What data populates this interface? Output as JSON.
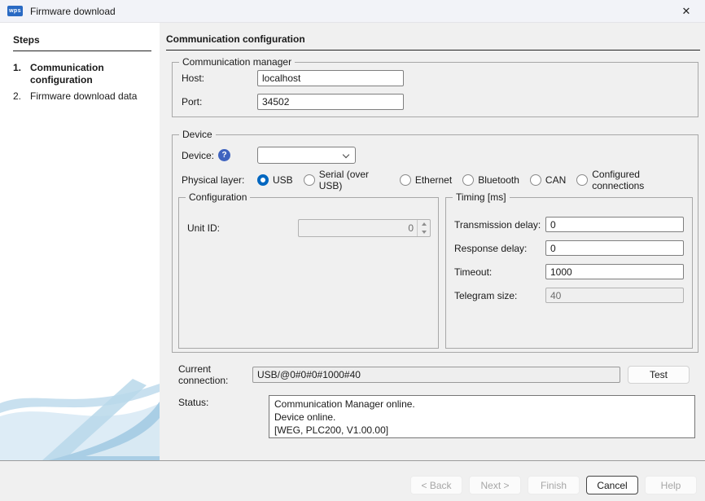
{
  "window": {
    "logo": "wps",
    "title": "Firmware download",
    "close_icon": "✕"
  },
  "sidebar": {
    "heading": "Steps",
    "steps": [
      {
        "number": "1.",
        "label": "Communication configuration",
        "active": true
      },
      {
        "number": "2.",
        "label": "Firmware download data",
        "active": false
      }
    ]
  },
  "main": {
    "heading": "Communication configuration",
    "comm_manager": {
      "legend": "Communication manager",
      "host_label": "Host:",
      "host_value": "localhost",
      "port_label": "Port:",
      "port_value": "34502"
    },
    "device": {
      "legend": "Device",
      "device_label": "Device:",
      "help_icon_text": "?",
      "device_value": "",
      "physical_layer_label": "Physical layer:",
      "options": [
        {
          "label": "USB",
          "selected": true
        },
        {
          "label": "Serial (over USB)",
          "selected": false
        },
        {
          "label": "Ethernet",
          "selected": false
        },
        {
          "label": "Bluetooth",
          "selected": false
        },
        {
          "label": "CAN",
          "selected": false
        },
        {
          "label": "Configured connections",
          "selected": false
        }
      ],
      "configuration": {
        "legend": "Configuration",
        "unit_id_label": "Unit ID:",
        "unit_id_value": "0",
        "unit_id_disabled": true
      },
      "timing": {
        "legend": "Timing [ms]",
        "rows": [
          {
            "label": "Transmission delay:",
            "value": "0",
            "disabled": false
          },
          {
            "label": "Response delay:",
            "value": "0",
            "disabled": false
          },
          {
            "label": "Timeout:",
            "value": "1000",
            "disabled": false
          },
          {
            "label": "Telegram size:",
            "value": "40",
            "disabled": true
          }
        ]
      }
    },
    "connection": {
      "label": "Current connection:",
      "value": "USB/@0#0#0#1000#40",
      "test_button": "Test"
    },
    "status": {
      "label": "Status:",
      "lines": [
        "Communication Manager online.",
        "Device online.",
        "[WEG, PLC200, V1.00.00]"
      ]
    }
  },
  "footer": {
    "buttons": [
      {
        "label": "< Back",
        "disabled": true,
        "default": false
      },
      {
        "label": "Next >",
        "disabled": true,
        "default": false
      },
      {
        "label": "Finish",
        "disabled": true,
        "default": false
      },
      {
        "label": "Cancel",
        "disabled": false,
        "default": true
      },
      {
        "label": "Help",
        "disabled": true,
        "default": false
      }
    ]
  },
  "colors": {
    "accent": "#0067c0",
    "help_icon": "#3f63bf",
    "sidebar_bg": "#ffffff",
    "main_bg": "#f0f0f0"
  }
}
